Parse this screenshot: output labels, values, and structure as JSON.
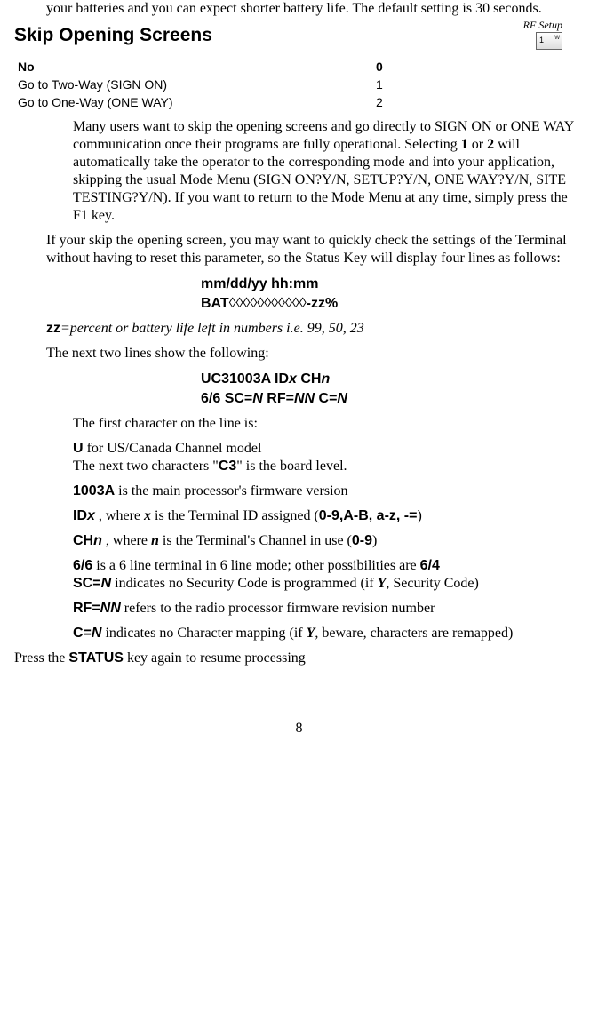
{
  "intro": "your batteries and you can expect shorter battery life. The default setting is 30 seconds.",
  "heading": "Skip Opening Screens",
  "rf_setup_label": "RF Setup",
  "rf_icon_text": "1",
  "rf_icon_sub": "w",
  "options": [
    {
      "label": "No",
      "value": "0"
    },
    {
      "label": "Go to Two-Way (SIGN ON)",
      "value": "1"
    },
    {
      "label": "Go to One-Way (ONE WAY)",
      "value": "2"
    }
  ],
  "para1a": "Many users want to skip the opening screens and go directly to SIGN ON or ONE WAY communication once their programs are fully operational. Selecting ",
  "para1b": "1",
  "para1c": " or ",
  "para1d": "2",
  "para1e": " will automatically take the operator to the corresponding mode and into your application, skipping the usual Mode Menu (SIGN ON?Y/N, SETUP?Y/N, ONE WAY?Y/N, SITE TESTING?Y/N). If you want to return to the Mode Menu at any time, simply press the F1 key.",
  "para2": "If your skip the opening screen, you may want to quickly check the settings of the Terminal without having to reset this parameter, so the Status Key will display four lines as follows:",
  "status_line1": "mm/dd/yy  hh:mm",
  "status_line2a": "BAT",
  "status_line2b": "◊◊◊◊◊◊◊◊◊◊◊",
  "status_line2c": "-zz%",
  "zz_bold": "zz",
  "zz_eq": "=",
  "zz_desc": "percent or battery life left in numbers i.e. 99, 50, 23",
  "para3": "The next two lines show the following:",
  "uc_line1a": "UC31003A ID",
  "uc_line1b": "x",
  "uc_line1c": " CH",
  "uc_line1d": "n",
  "uc_line2a": "6/6 SC=",
  "uc_line2b": "N",
  "uc_line2c": " RF=",
  "uc_line2d": "NN",
  "uc_line2e": " C=",
  "uc_line2f": "N",
  "para4": "The first character on the line is:",
  "u_bold": "U",
  "u_desc1": " for US/Canada Channel model",
  "u_desc2a": "The next two characters \"",
  "u_desc2b": "C3",
  "u_desc2c": "\" is the board level.",
  "p1003a": "1003A",
  "p1003b": " is the main processor's firmware version",
  "id_a": "ID",
  "id_b": "x",
  "id_c": " , where ",
  "id_d": "x",
  "id_e": " is the Terminal ID assigned (",
  "id_f": "0-9,A-B, a-z, -=",
  "id_g": ")",
  "ch_a": "CH",
  "ch_b": "n",
  "ch_c": " , where ",
  "ch_d": "n",
  "ch_e": " is the Terminal's Channel in use  (",
  "ch_f": "0-9",
  "ch_g": ")",
  "six_a": "6/6",
  "six_b": " is a 6 line terminal in 6 line mode; other possibilities are ",
  "six_c": "6/4",
  "sc_a": "SC=",
  "sc_b": "N",
  "sc_c": " indicates no Security Code is programmed (if ",
  "sc_d": "Y",
  "sc_e": ", Security Code)",
  "rf_a": "RF=",
  "rf_b": "NN",
  "rf_c": " refers to the radio processor firmware revision number",
  "cn_a": "C=",
  "cn_b": "N",
  "cn_c": " indicates no Character mapping (if ",
  "cn_d": "Y",
  "cn_e": ", beware, characters are remapped)",
  "press_a": "Press the ",
  "press_b": "STATUS",
  "press_c": " key again to resume processing",
  "page_number": "8"
}
